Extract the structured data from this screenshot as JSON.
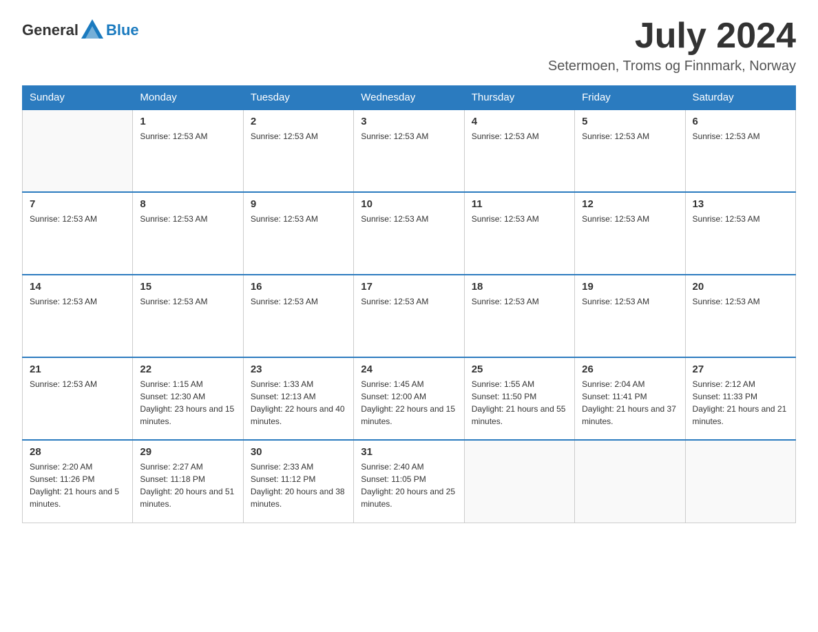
{
  "header": {
    "logo_text_general": "General",
    "logo_text_blue": "Blue",
    "month_title": "July 2024",
    "location": "Setermoen, Troms og Finnmark, Norway"
  },
  "days_of_week": [
    "Sunday",
    "Monday",
    "Tuesday",
    "Wednesday",
    "Thursday",
    "Friday",
    "Saturday"
  ],
  "weeks": [
    [
      {
        "day": "",
        "info": ""
      },
      {
        "day": "1",
        "info": "Sunrise: 12:53 AM"
      },
      {
        "day": "2",
        "info": "Sunrise: 12:53 AM"
      },
      {
        "day": "3",
        "info": "Sunrise: 12:53 AM"
      },
      {
        "day": "4",
        "info": "Sunrise: 12:53 AM"
      },
      {
        "day": "5",
        "info": "Sunrise: 12:53 AM"
      },
      {
        "day": "6",
        "info": "Sunrise: 12:53 AM"
      }
    ],
    [
      {
        "day": "7",
        "info": "Sunrise: 12:53 AM"
      },
      {
        "day": "8",
        "info": "Sunrise: 12:53 AM"
      },
      {
        "day": "9",
        "info": "Sunrise: 12:53 AM"
      },
      {
        "day": "10",
        "info": "Sunrise: 12:53 AM"
      },
      {
        "day": "11",
        "info": "Sunrise: 12:53 AM"
      },
      {
        "day": "12",
        "info": "Sunrise: 12:53 AM"
      },
      {
        "day": "13",
        "info": "Sunrise: 12:53 AM"
      }
    ],
    [
      {
        "day": "14",
        "info": "Sunrise: 12:53 AM"
      },
      {
        "day": "15",
        "info": "Sunrise: 12:53 AM"
      },
      {
        "day": "16",
        "info": "Sunrise: 12:53 AM"
      },
      {
        "day": "17",
        "info": "Sunrise: 12:53 AM"
      },
      {
        "day": "18",
        "info": "Sunrise: 12:53 AM"
      },
      {
        "day": "19",
        "info": "Sunrise: 12:53 AM"
      },
      {
        "day": "20",
        "info": "Sunrise: 12:53 AM"
      }
    ],
    [
      {
        "day": "21",
        "info": "Sunrise: 12:53 AM"
      },
      {
        "day": "22",
        "info": "Sunrise: 1:15 AM\nSunset: 12:30 AM\nDaylight: 23 hours and 15 minutes."
      },
      {
        "day": "23",
        "info": "Sunrise: 1:33 AM\nSunset: 12:13 AM\nDaylight: 22 hours and 40 minutes."
      },
      {
        "day": "24",
        "info": "Sunrise: 1:45 AM\nSunset: 12:00 AM\nDaylight: 22 hours and 15 minutes."
      },
      {
        "day": "25",
        "info": "Sunrise: 1:55 AM\nSunset: 11:50 PM\nDaylight: 21 hours and 55 minutes."
      },
      {
        "day": "26",
        "info": "Sunrise: 2:04 AM\nSunset: 11:41 PM\nDaylight: 21 hours and 37 minutes."
      },
      {
        "day": "27",
        "info": "Sunrise: 2:12 AM\nSunset: 11:33 PM\nDaylight: 21 hours and 21 minutes."
      }
    ],
    [
      {
        "day": "28",
        "info": "Sunrise: 2:20 AM\nSunset: 11:26 PM\nDaylight: 21 hours and 5 minutes."
      },
      {
        "day": "29",
        "info": "Sunrise: 2:27 AM\nSunset: 11:18 PM\nDaylight: 20 hours and 51 minutes."
      },
      {
        "day": "30",
        "info": "Sunrise: 2:33 AM\nSunset: 11:12 PM\nDaylight: 20 hours and 38 minutes."
      },
      {
        "day": "31",
        "info": "Sunrise: 2:40 AM\nSunset: 11:05 PM\nDaylight: 20 hours and 25 minutes."
      },
      {
        "day": "",
        "info": ""
      },
      {
        "day": "",
        "info": ""
      },
      {
        "day": "",
        "info": ""
      }
    ]
  ]
}
